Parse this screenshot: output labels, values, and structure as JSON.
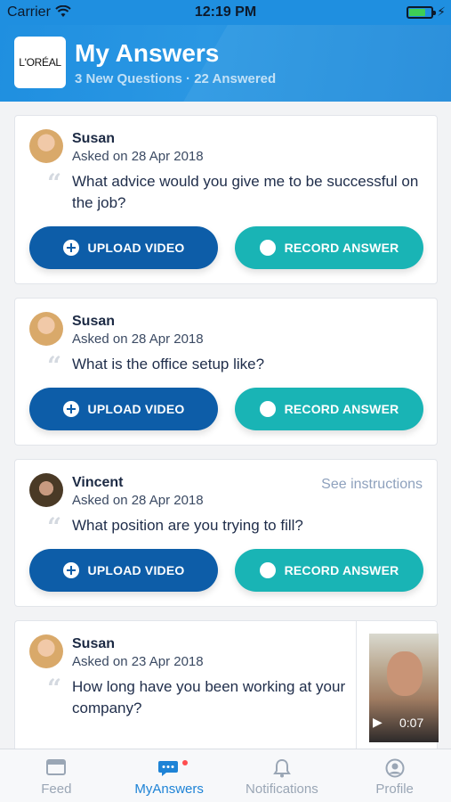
{
  "status_bar": {
    "carrier": "Carrier",
    "time": "12:19 PM"
  },
  "header": {
    "logo_text": "L'ORÉAL",
    "title": "My Answers",
    "subtitle": "3 New Questions · 22 Answered"
  },
  "cards": [
    {
      "name": "Susan",
      "asked": "Asked on 28 Apr 2018",
      "question": "What advice would you give me to be successful on the job?",
      "upload_label": "UPLOAD VIDEO",
      "record_label": "RECORD ANSWER"
    },
    {
      "name": "Susan",
      "asked": "Asked on 28 Apr 2018",
      "question": "What is the office setup like?",
      "upload_label": "UPLOAD VIDEO",
      "record_label": "RECORD ANSWER"
    },
    {
      "name": "Vincent",
      "asked": "Asked on 28 Apr 2018",
      "question": "What position are you trying to fill?",
      "see_instructions": "See instructions",
      "upload_label": "UPLOAD VIDEO",
      "record_label": "RECORD ANSWER"
    },
    {
      "name": "Susan",
      "asked": "Asked on 23 Apr 2018",
      "question": "How long have you been working at your company?",
      "video_duration": "0:07"
    }
  ],
  "tabbar": [
    {
      "label": "Feed",
      "icon": "feed-icon"
    },
    {
      "label": "MyAnswers",
      "icon": "chat-bubble-icon",
      "active": true
    },
    {
      "label": "Notifications",
      "icon": "bell-icon"
    },
    {
      "label": "Profile",
      "icon": "profile-icon"
    }
  ],
  "colors": {
    "accent": "#1e83d6",
    "upload_button": "#0d5da8",
    "record_button": "#19b4b5"
  }
}
